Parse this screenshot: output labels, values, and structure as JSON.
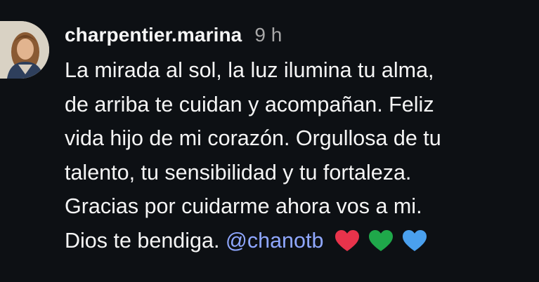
{
  "comment": {
    "username": "charpentier.marina",
    "timestamp": "9 h",
    "lines": [
      "La mirada al sol, la luz ilumina tu alma,",
      "de arriba te cuidan y acompañan.  Feliz",
      "vida hijo de mi corazón. Orgullosa de tu",
      "talento, tu sensibilidad y tu fortaleza.",
      "Gracias por cuidarme ahora vos a mi.",
      "Dios te bendiga."
    ],
    "mention": "@chanotb",
    "hearts": [
      {
        "icon": "red-heart-icon",
        "color": "#e8334b"
      },
      {
        "icon": "green-heart-icon",
        "color": "#1fa84a"
      },
      {
        "icon": "blue-heart-icon",
        "color": "#4aa0ee"
      }
    ]
  }
}
